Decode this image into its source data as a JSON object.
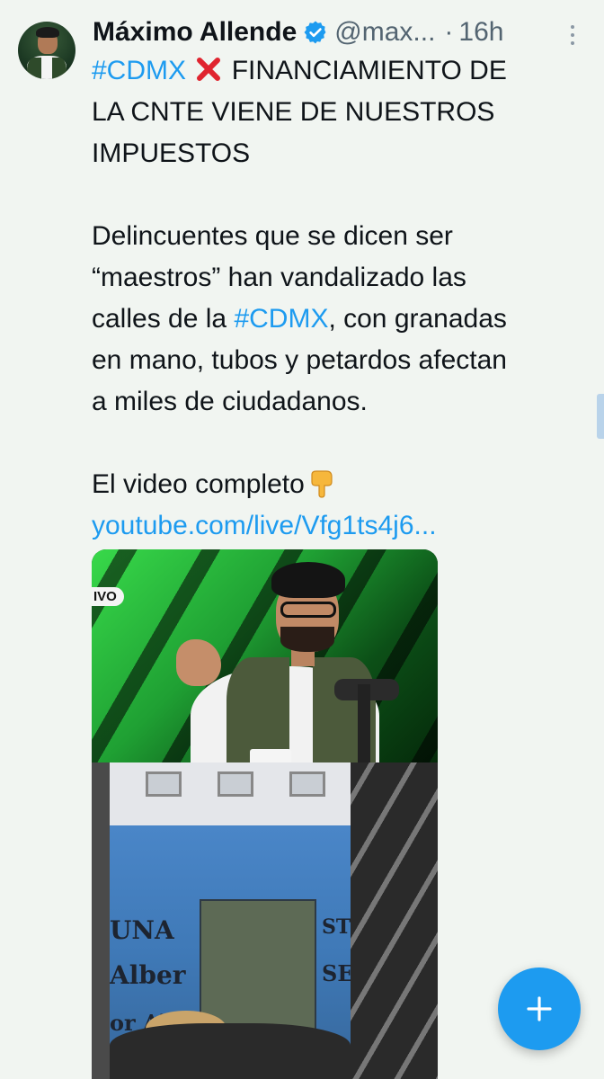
{
  "tweet": {
    "author_name": "Máximo Allende",
    "author_handle": "@max...",
    "separator": "·",
    "timestamp": "16h",
    "verified": true,
    "lines": {
      "l1_tag": "#CDMX",
      "l1_rest": "FINANCIAMIENTO DE",
      "l2": "LA CNTE VIENE DE NUESTROS",
      "l3": "IMPUESTOS",
      "l4": "Delincuentes que se dicen ser",
      "l5": "“maestros” han vandalizado las",
      "l6_pre": "calles de la",
      "l6_tag": "#CDMX",
      "l6_post": ", con granadas",
      "l7": "en mano, tubos y petardos afectan",
      "l8": "a miles de ciudadanos.",
      "l9": "El video completo",
      "link": "youtube.com/live/Vfg1ts4j6..."
    },
    "emoji": {
      "cross": "cross-mark-emoji",
      "point_down": "backhand-index-pointing-down-emoji"
    }
  },
  "media": {
    "studio_logo": "IVO",
    "graffiti": [
      "UNA",
      "Alber",
      "or Alum",
      "STE",
      "SE"
    ]
  },
  "colors": {
    "accent": "#1d9bf0",
    "text": "#0f1419",
    "secondary": "#536471",
    "background": "#f1f5f1"
  },
  "fab": {
    "icon": "plus-icon"
  }
}
